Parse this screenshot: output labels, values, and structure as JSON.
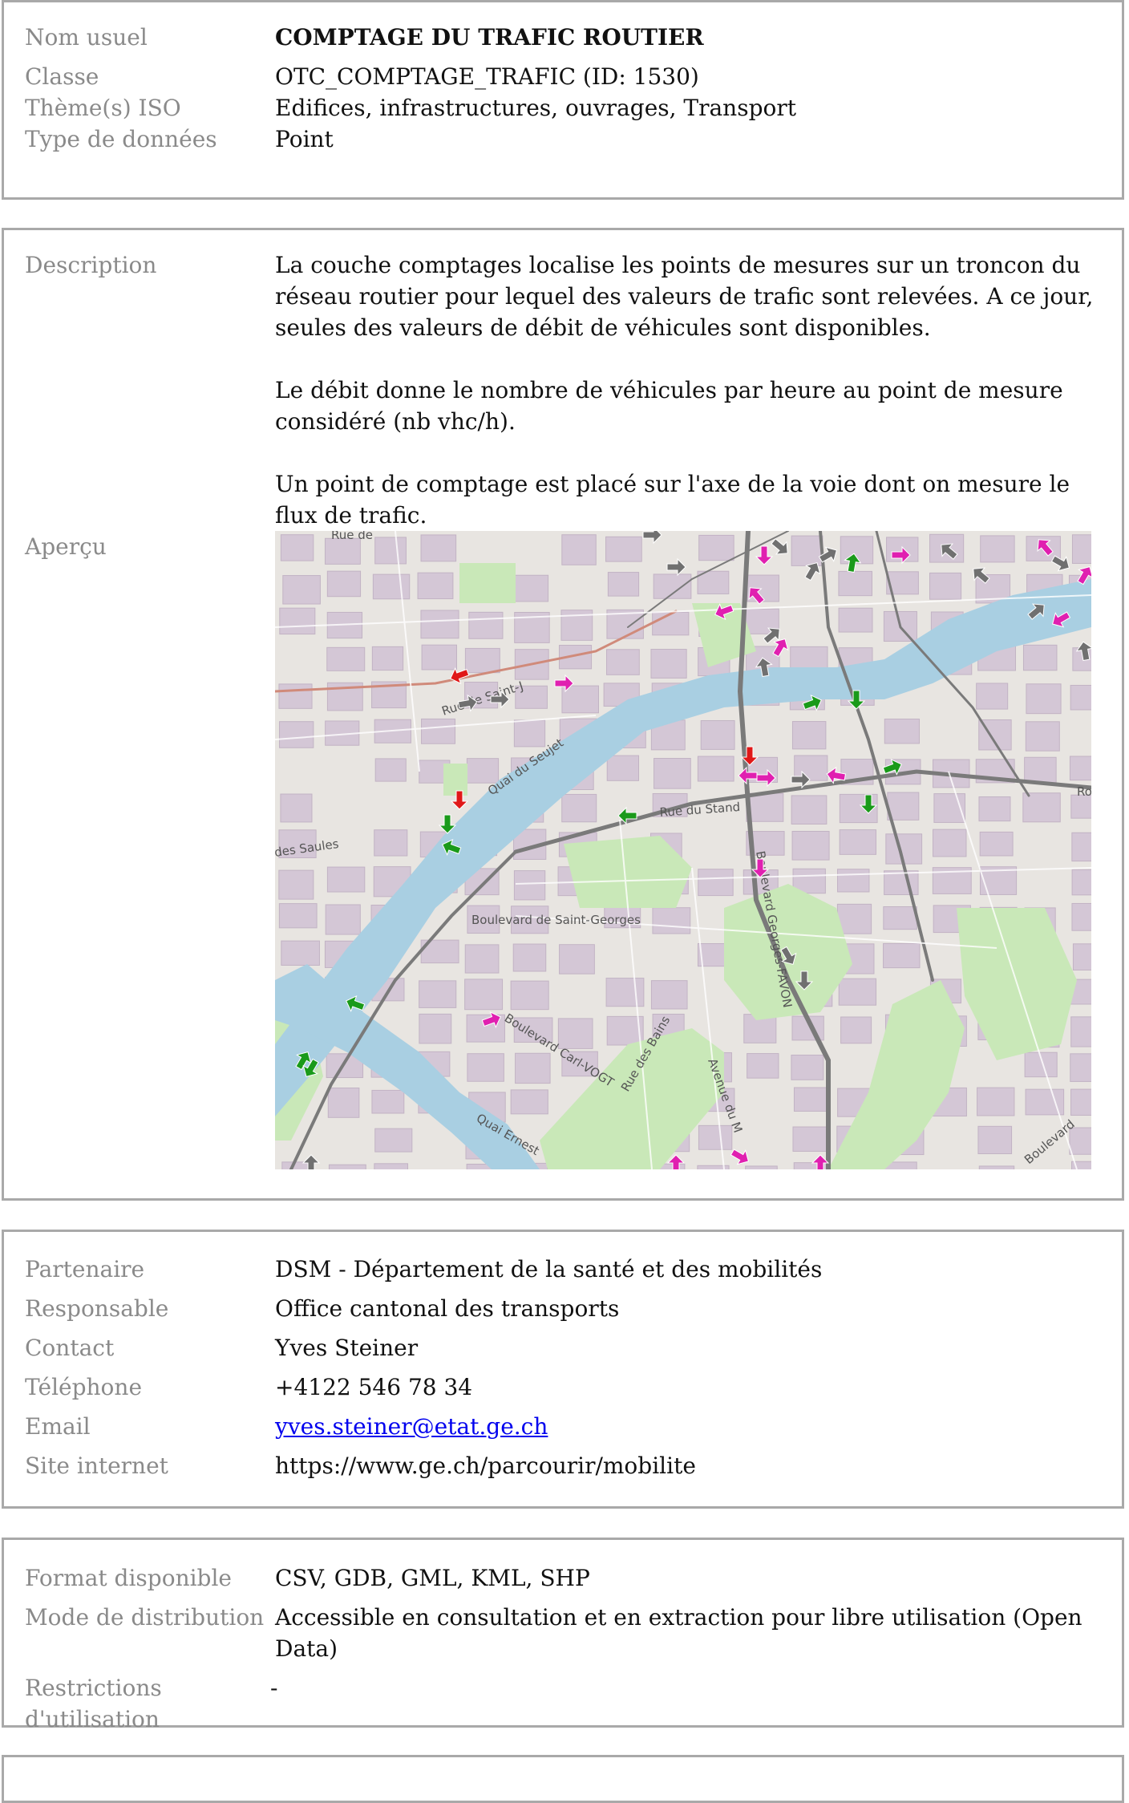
{
  "identity": {
    "nom_usuel_label": "Nom usuel",
    "nom_usuel": "COMPTAGE DU TRAFIC ROUTIER",
    "classe_label": "Classe",
    "classe": "OTC_COMPTAGE_TRAFIC (ID: 1530)",
    "theme_label": "Thème(s) ISO",
    "theme": "Edifices, infrastructures, ouvrages, Transport",
    "type_label": "Type de données",
    "type": "Point"
  },
  "description": {
    "label": "Description",
    "paragraphs": [
      "La couche comptages localise les points de mesures sur un troncon du réseau routier pour lequel des valeurs de trafic sont relevées. A ce jour, seules des valeurs de débit de véhicules sont disponibles.",
      "Le débit donne le nombre de véhicules par heure au point de mesure considéré (nb vhc/h).",
      "Un point de comptage est placé sur l'axe de la voie dont on mesure le flux de trafic."
    ],
    "apercu_label": "Aperçu"
  },
  "map": {
    "street_labels": [
      "Rue de",
      "Rue de Saint-J",
      "Quai du Seujet",
      "Rue du Stand",
      "des Saules",
      "Boulevard de Saint-Georges",
      "Boulevard Georges-FAVON",
      "Boulevard Carl-VOGT",
      "Rue des Bains",
      "Avenue du M",
      "Quai Ernest",
      "Boulevard",
      "Ro"
    ],
    "colors": {
      "water": "#a9cfe2",
      "building": "#d6c9d8",
      "park": "#c7e7b4",
      "green_arrow": "#1a9a1a",
      "magenta_arrow": "#e020b0",
      "red_arrow": "#e01818",
      "gray_arrow": "#707070"
    }
  },
  "contact": {
    "partenaire_label": "Partenaire",
    "partenaire": "DSM - Département de la santé et des mobilités",
    "responsable_label": "Responsable",
    "responsable": "Office cantonal des transports",
    "contact_label": "Contact",
    "contact": "Yves Steiner",
    "telephone_label": "Téléphone",
    "telephone": "+4122 546 78 34",
    "email_label": "Email",
    "email": "yves.steiner@etat.ge.ch",
    "site_label": "Site internet",
    "site": "https://www.ge.ch/parcourir/mobilite"
  },
  "distribution": {
    "format_label": "Format disponible",
    "format": "CSV, GDB, GML, KML, SHP",
    "mode_label": "Mode de distribution",
    "mode": "Accessible en consultation et en extraction pour libre utilisation (Open Data)",
    "restrictions_label": "Restrictions d'utilisation",
    "restrictions": "-"
  }
}
